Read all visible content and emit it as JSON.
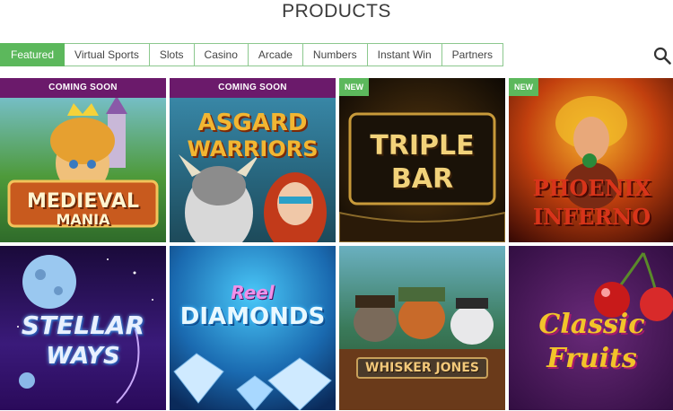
{
  "page": {
    "title": "PRODUCTS"
  },
  "tabs": [
    {
      "label": "Featured",
      "active": true
    },
    {
      "label": "Virtual Sports"
    },
    {
      "label": "Slots"
    },
    {
      "label": "Casino"
    },
    {
      "label": "Arcade"
    },
    {
      "label": "Numbers"
    },
    {
      "label": "Instant Win"
    },
    {
      "label": "Partners"
    }
  ],
  "search": {
    "icon": "search-icon"
  },
  "games": [
    {
      "banner": "COMING SOON",
      "title_line1": "MEDIEVAL",
      "title_line2": "MANIA"
    },
    {
      "banner": "COMING SOON",
      "title_line1": "ASGARD",
      "title_line2": "WARRIORS"
    },
    {
      "badge": "NEW",
      "title_line1": "TRIPLE",
      "title_line2": "BAR"
    },
    {
      "badge": "NEW",
      "title_line1": "PHOENIX",
      "title_line2": "INFERNO"
    },
    {
      "title_line1": "STELLAR",
      "title_line2": "WAYS"
    },
    {
      "title_line1": "Reel",
      "title_line2": "DIAMONDS"
    },
    {
      "title_line1": "WHISKER JONES"
    },
    {
      "title_line1": "Classic",
      "title_line2": "Fruits"
    }
  ],
  "colors": {
    "accent": "#5cb85c",
    "banner": "#6b1a6b"
  }
}
